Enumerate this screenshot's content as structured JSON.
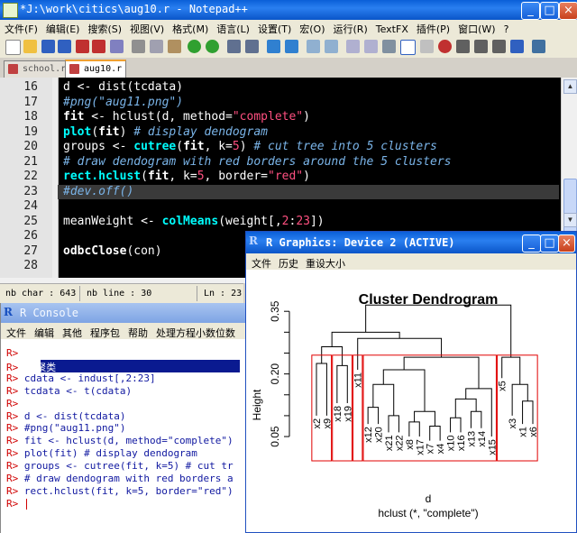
{
  "notepad": {
    "title": "*J:\\work\\citics\\aug10.r - Notepad++",
    "menu": [
      "文件(F)",
      "编辑(E)",
      "搜索(S)",
      "视图(V)",
      "格式(M)",
      "语言(L)",
      "设置(T)",
      "宏(O)",
      "运行(R)",
      "TextFX",
      "插件(P)",
      "窗口(W)",
      "?"
    ],
    "tabs": [
      "school.r",
      "aug10.r"
    ],
    "line_numbers": [
      "16",
      "17",
      "18",
      "19",
      "20",
      "21",
      "22",
      "23",
      "24",
      "25",
      "26",
      "27",
      "28"
    ],
    "status": {
      "chars": "nb char : 643",
      "lines": "nb line : 30",
      "ln": "Ln : 23"
    }
  },
  "rconsole": {
    "title": "R Console",
    "menu": [
      "文件",
      "编辑",
      "其他",
      "程序包",
      "帮助",
      "处理方程小数位数"
    ],
    "lines": [
      {
        "p": "R>",
        "c": ""
      },
      {
        "p": "R>",
        "c": "##聚类"
      },
      {
        "p": "R>",
        "c": "cdata <- indust[,2:23]"
      },
      {
        "p": "R>",
        "c": "tcdata <- t(cdata)"
      },
      {
        "p": "R>",
        "c": ""
      },
      {
        "p": "R>",
        "c": "d <- dist(tcdata)"
      },
      {
        "p": "R>",
        "c": "#png(\"aug11.png\")"
      },
      {
        "p": "R>",
        "c": "fit <- hclust(d, method=\"complete\")"
      },
      {
        "p": "R>",
        "c": "plot(fit) # display dendogram"
      },
      {
        "p": "R>",
        "c": "groups <- cutree(fit, k=5) # cut tr"
      },
      {
        "p": "R>",
        "c": "# draw dendogram with red borders a"
      },
      {
        "p": "R>",
        "c": "rect.hclust(fit, k=5, border=\"red\")"
      },
      {
        "p": "R>",
        "c": ""
      }
    ]
  },
  "rgraphics": {
    "title": "R Graphics: Device 2 (ACTIVE)",
    "menu": [
      "文件",
      "历史",
      "重设大小"
    ]
  },
  "chart_data": {
    "type": "dendrogram",
    "title": "Cluster Dendrogram",
    "ylabel": "Height",
    "xlabel": "d",
    "sub": "hclust (*, \"complete\")",
    "yticks": [
      "0.05",
      "0.20",
      "0.35"
    ],
    "yticks_extra": [
      "0.10",
      "0.15",
      "0.25",
      "0.30"
    ],
    "ylim": [
      0.0,
      0.4
    ],
    "leaves": [
      "x2",
      "x9",
      "x18",
      "x19",
      "x11",
      "x12",
      "x20",
      "x21",
      "x22",
      "x8",
      "x17",
      "x7",
      "x4",
      "x10",
      "x16",
      "x13",
      "x14",
      "x15",
      "x5",
      "x3",
      "x1",
      "x6"
    ],
    "leaf_values": [
      0.1,
      0.1,
      0.13,
      0.13,
      0.21,
      0.08,
      0.08,
      0.06,
      0.06,
      0.05,
      0.05,
      0.04,
      0.04,
      0.06,
      0.06,
      0.07,
      0.07,
      0.05,
      0.19,
      0.1,
      0.08,
      0.08
    ],
    "clusters": [
      [
        "x2",
        "x9"
      ],
      [
        "x18",
        "x19"
      ],
      [
        "x11"
      ],
      [
        "x12",
        "x20",
        "x21",
        "x22",
        "x8",
        "x17",
        "x7",
        "x4",
        "x10",
        "x16",
        "x13",
        "x14",
        "x15"
      ],
      [
        "x5",
        "x3",
        "x1",
        "x6"
      ]
    ],
    "border_color": "#e00000"
  }
}
